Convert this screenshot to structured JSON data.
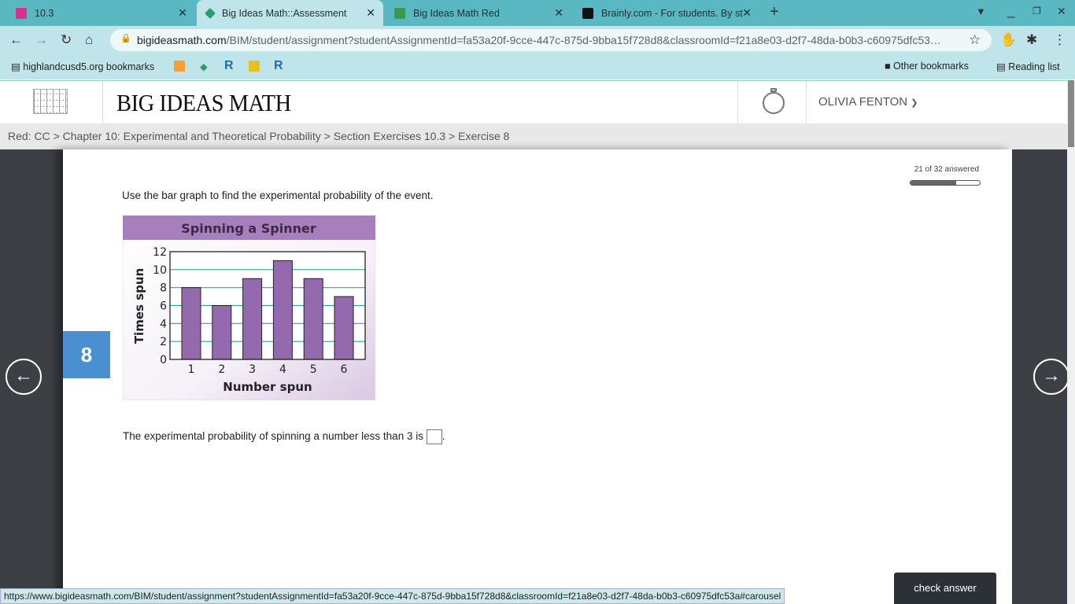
{
  "browser": {
    "tabs": [
      {
        "title": "10.3",
        "active": false
      },
      {
        "title": "Big Ideas Math::Assessment",
        "active": true
      },
      {
        "title": "Big Ideas Math Red",
        "active": false
      },
      {
        "title": "Brainly.com - For students. By st",
        "active": false
      }
    ],
    "url_domain": "bigideasmath.com",
    "url_path": "/BIM/student/assignment?studentAssignmentId=fa53a20f-9cce-447c-875d-9bba15f728d8&classroomId=f21a8e03-d2f7-48da-b0b3-c60975dfc53…",
    "bookmarks_folder": "highlandcusd5.org bookmarks",
    "other_bookmarks": "Other bookmarks",
    "reading_list": "Reading list",
    "status_url": "https://www.bigideasmath.com/BIM/student/assignment?studentAssignmentId=fa53a20f-9cce-447c-875d-9bba15f728d8&classroomId=f21a8e03-d2f7-48da-b0b3-c60975dfc53a#carousel"
  },
  "header": {
    "logo": "BIG IDEAS MATH",
    "user": "OLIVIA FENTON"
  },
  "breadcrumb": "Red: CC > Chapter 10: Experimental and Theoretical Probability > Section Exercises 10.3 > Exercise 8",
  "progress": {
    "label": "21 of 32 answered",
    "answered": 21,
    "total": 32
  },
  "question": {
    "number": "8",
    "prompt": "Use the bar graph to find the experimental probability of the event.",
    "answer_text": "The experimental probability of spinning a number less than 3 is",
    "answer_value": ""
  },
  "check_answer": "check answer",
  "chart_data": {
    "type": "bar",
    "title": "Spinning a Spinner",
    "xlabel": "Number spun",
    "ylabel": "Times spun",
    "categories": [
      "1",
      "2",
      "3",
      "4",
      "5",
      "6"
    ],
    "values": [
      8,
      6,
      9,
      11,
      9,
      7
    ],
    "ylim": [
      0,
      12
    ],
    "yticks": [
      "0",
      "2",
      "4",
      "6",
      "8",
      "10",
      "12"
    ],
    "grid": true,
    "bar_color": "#9469ad"
  }
}
